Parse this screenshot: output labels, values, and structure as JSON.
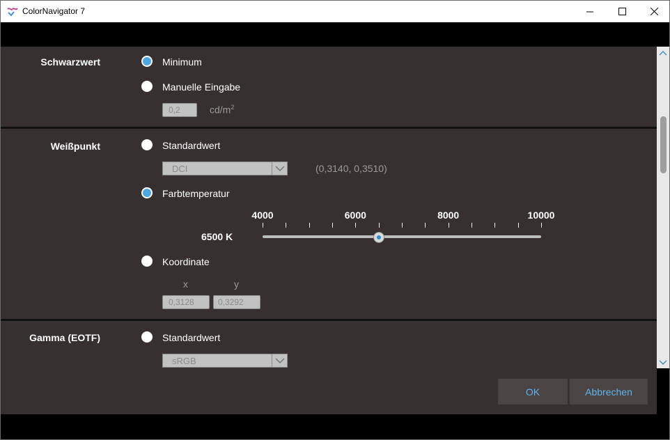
{
  "window": {
    "title": "ColorNavigator 7"
  },
  "black_level": {
    "label": "Schwarzwert",
    "options": [
      "Minimum",
      "Manuelle Eingabe"
    ],
    "value": "0,2",
    "unit": "cd/m",
    "unit_sup": "2"
  },
  "white_point": {
    "label": "Weißpunkt",
    "opt_standard": "Standardwert",
    "standard_select": "DCI",
    "standard_coords": "(0,3140, 0,3510)",
    "opt_temperature": "Farbtemperatur",
    "temperature_value": "6500 K",
    "temperature_numeric": 6500,
    "scale_min": 4000,
    "scale_max": 10000,
    "tick_labels": [
      "4000",
      "6000",
      "8000",
      "10000"
    ],
    "opt_coordinates": "Koordinate",
    "x_label": "x",
    "y_label": "y",
    "x_value": "0,3128",
    "y_value": "0,3292"
  },
  "gamma": {
    "label": "Gamma (EOTF)",
    "opt_standard": "Standardwert",
    "select_value": "sRGB"
  },
  "buttons": {
    "ok": "OK",
    "cancel": "Abbrechen"
  },
  "colors": {
    "accent": "#4ea7e0",
    "panel": "#363030",
    "button_text": "#62b5ea"
  }
}
